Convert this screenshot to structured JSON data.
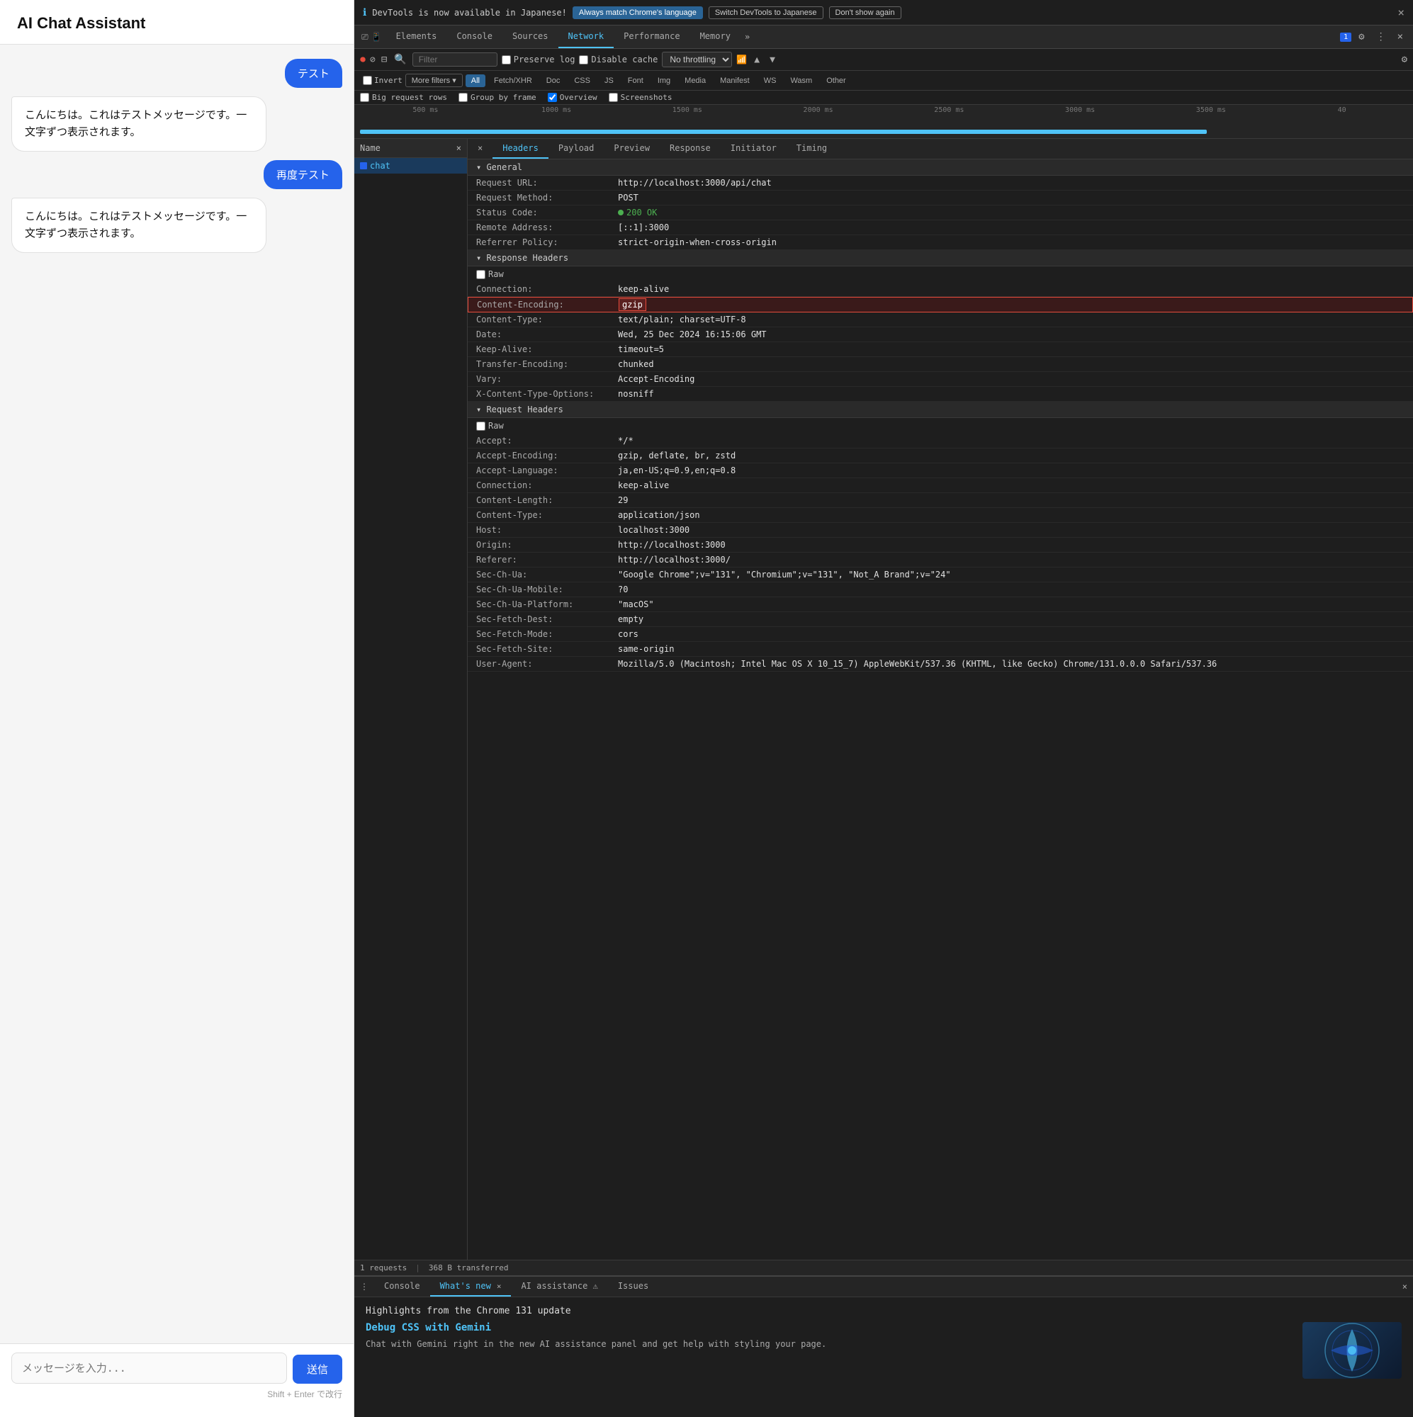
{
  "chat": {
    "title": "AI Chat Assistant",
    "messages": [
      {
        "role": "user",
        "text": "テスト"
      },
      {
        "role": "ai",
        "text": "こんにちは。これはテストメッセージです。一文字ずつ表示されます。"
      },
      {
        "role": "user",
        "text": "再度テスト"
      },
      {
        "role": "ai",
        "text": "こんにちは。これはテストメッセージです。一文字ずつ表示されます。"
      }
    ],
    "input_placeholder": "メッセージを入力...",
    "send_label": "送信",
    "hint": "Shift + Enter で改行"
  },
  "devtools": {
    "info_bar": {
      "icon": "ℹ",
      "message": "DevTools is now available in Japanese!",
      "btn1": "Always match Chrome's language",
      "btn2": "Switch DevTools to Japanese",
      "btn3": "Don't show again",
      "close": "×"
    },
    "tabs": [
      "Elements",
      "Console",
      "Sources",
      "Network",
      "Performance",
      "Memory",
      "»"
    ],
    "active_tab": "Network",
    "tab_icons": [
      "⚙",
      "⋮",
      "×"
    ],
    "badge": "1",
    "toolbar": {
      "record_icon": "⏺",
      "clear_icon": "🚫",
      "filter_icon": "⊟",
      "search_icon": "🔍",
      "filter_placeholder": "Filter",
      "preserve_log": "Preserve log",
      "disable_cache": "Disable cache",
      "throttle": "No throttling",
      "icons": [
        "⊠",
        "▲",
        "▼"
      ],
      "settings": "⚙"
    },
    "filter_types": {
      "invert": "Invert",
      "more_filters": "More filters ▾",
      "types": [
        "All",
        "Fetch/XHR",
        "Doc",
        "CSS",
        "JS",
        "Font",
        "Img",
        "Media",
        "Manifest",
        "WS",
        "Wasm",
        "Other"
      ]
    },
    "active_filter": "All",
    "options": {
      "big_request_rows": "Big request rows",
      "overview": "Overview",
      "group_by_frame": "Group by frame",
      "screenshots": "Screenshots"
    },
    "timeline": {
      "marks": [
        "500 ms",
        "1000 ms",
        "1500 ms",
        "2000 ms",
        "2500 ms",
        "3000 ms",
        "3500 ms",
        "40"
      ]
    },
    "name_panel": {
      "header": "Name",
      "items": [
        {
          "name": "chat",
          "selected": true
        }
      ]
    },
    "detail": {
      "tabs": [
        "Headers",
        "Payload",
        "Preview",
        "Response",
        "Initiator",
        "Timing"
      ],
      "active_tab": "Headers",
      "general": {
        "title": "General",
        "rows": [
          {
            "key": "Request URL:",
            "val": "http://localhost:3000/api/chat"
          },
          {
            "key": "Request Method:",
            "val": "POST"
          },
          {
            "key": "Status Code:",
            "val": "200 OK",
            "status": true
          },
          {
            "key": "Remote Address:",
            "val": "[::1]:3000"
          },
          {
            "key": "Referrer Policy:",
            "val": "strict-origin-when-cross-origin"
          }
        ]
      },
      "response_headers": {
        "title": "Response Headers",
        "raw_label": "Raw",
        "rows": [
          {
            "key": "Connection:",
            "val": "keep-alive"
          },
          {
            "key": "Content-Encoding:",
            "val": "gzip",
            "highlighted": true
          },
          {
            "key": "Content-Type:",
            "val": "text/plain; charset=UTF-8"
          },
          {
            "key": "Date:",
            "val": "Wed, 25 Dec 2024 16:15:06 GMT"
          },
          {
            "key": "Keep-Alive:",
            "val": "timeout=5"
          },
          {
            "key": "Transfer-Encoding:",
            "val": "chunked"
          },
          {
            "key": "Vary:",
            "val": "Accept-Encoding"
          },
          {
            "key": "X-Content-Type-Options:",
            "val": "nosniff"
          }
        ]
      },
      "request_headers": {
        "title": "Request Headers",
        "raw_label": "Raw",
        "rows": [
          {
            "key": "Accept:",
            "val": "*/*"
          },
          {
            "key": "Accept-Encoding:",
            "val": "gzip, deflate, br, zstd"
          },
          {
            "key": "Accept-Language:",
            "val": "ja,en-US;q=0.9,en;q=0.8"
          },
          {
            "key": "Connection:",
            "val": "keep-alive"
          },
          {
            "key": "Content-Length:",
            "val": "29"
          },
          {
            "key": "Content-Type:",
            "val": "application/json"
          },
          {
            "key": "Host:",
            "val": "localhost:3000"
          },
          {
            "key": "Origin:",
            "val": "http://localhost:3000"
          },
          {
            "key": "Referer:",
            "val": "http://localhost:3000/"
          },
          {
            "key": "Sec-Ch-Ua:",
            "val": "\"Google Chrome\";v=\"131\", \"Chromium\";v=\"131\", \"Not_A Brand\";v=\"24\""
          },
          {
            "key": "Sec-Ch-Ua-Mobile:",
            "val": "?0"
          },
          {
            "key": "Sec-Ch-Ua-Platform:",
            "val": "\"macOS\""
          },
          {
            "key": "Sec-Fetch-Dest:",
            "val": "empty"
          },
          {
            "key": "Sec-Fetch-Mode:",
            "val": "cors"
          },
          {
            "key": "Sec-Fetch-Site:",
            "val": "same-origin"
          },
          {
            "key": "User-Agent:",
            "val": "Mozilla/5.0 (Macintosh; Intel Mac OS X 10_15_7) AppleWebKit/537.36 (KHTML, like Gecko) Chrome/131.0.0.0 Safari/537.36"
          }
        ]
      }
    },
    "status_bar": {
      "requests": "1 requests",
      "transferred": "368 B transferred"
    },
    "bottom": {
      "tabs": [
        "Console",
        "What's new",
        "AI assistance ⚠",
        "Issues"
      ],
      "active_tab": "What's new",
      "highlight_title": "Highlights from the Chrome 131 update",
      "feature_title": "Debug CSS with Gemini",
      "feature_text": "Chat with Gemini right in the new AI assistance panel and get help with styling your page."
    }
  }
}
